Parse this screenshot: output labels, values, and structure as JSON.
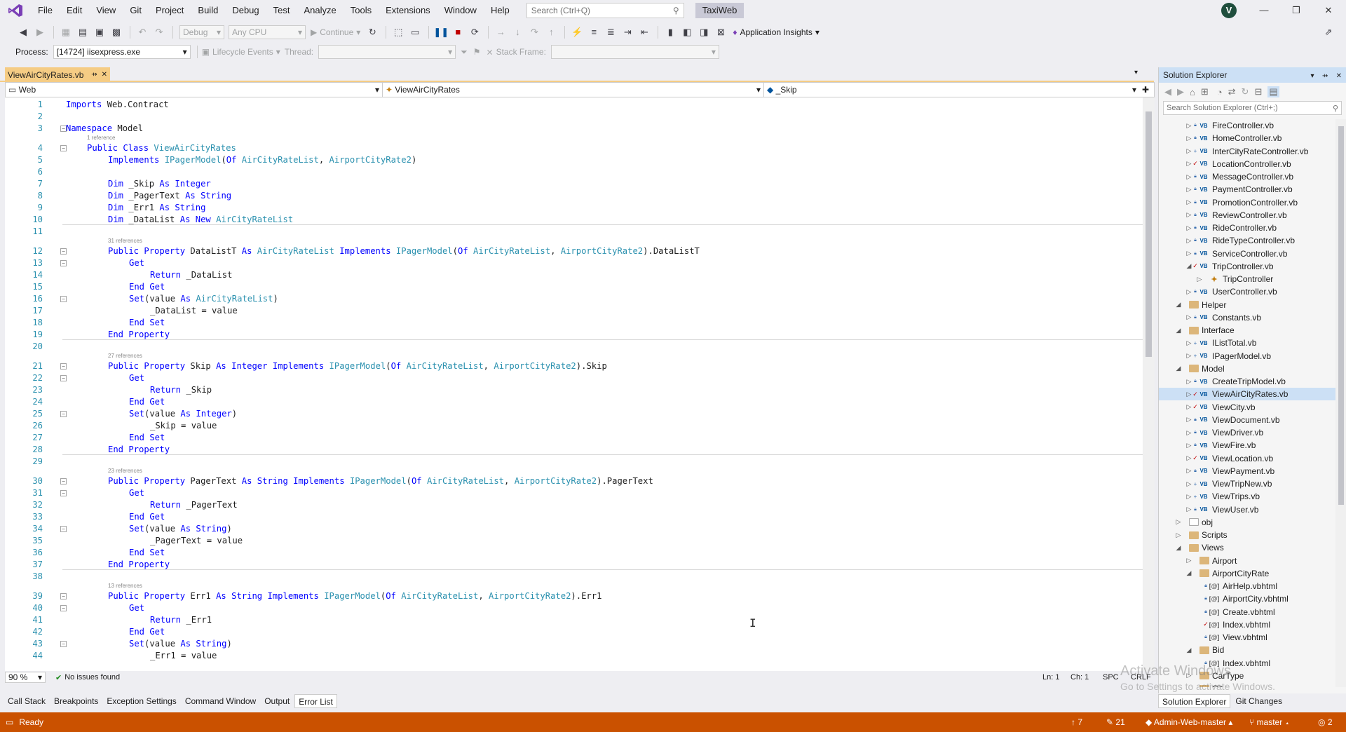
{
  "menu": [
    "File",
    "Edit",
    "View",
    "Git",
    "Project",
    "Build",
    "Debug",
    "Test",
    "Analyze",
    "Tools",
    "Extensions",
    "Window",
    "Help"
  ],
  "search": {
    "placeholder": "Search (Ctrl+Q)"
  },
  "project_name": "TaxiWeb",
  "user_initial": "V",
  "toolbar": {
    "config": "Debug",
    "platform": "Any CPU",
    "continue_label": "Continue",
    "app_insights": "Application Insights"
  },
  "debugbar": {
    "process_label": "Process:",
    "process_value": "[14724] iisexpress.exe",
    "lifecycle": "Lifecycle Events",
    "thread_label": "Thread:",
    "stack_label": "Stack Frame:"
  },
  "doc_tab": {
    "name": "ViewAirCityRates.vb",
    "pin": "⇸",
    "close": "✕"
  },
  "nav": {
    "project": "Web",
    "class": "ViewAirCityRates",
    "member": "_Skip"
  },
  "editor": {
    "lines": [
      {
        "n": "1",
        "ind": 0,
        "t": [
          [
            "k",
            "Imports"
          ],
          [
            "p",
            " Web.Contract"
          ]
        ]
      },
      {
        "n": "2",
        "ind": 0,
        "t": []
      },
      {
        "n": "3",
        "ind": 0,
        "f": "−",
        "t": [
          [
            "k",
            "Namespace"
          ],
          [
            "p",
            " Model"
          ]
        ]
      },
      {
        "n": "4",
        "ind": 1,
        "f": "−",
        "lens": "1 reference",
        "t": [
          [
            "k",
            "Public Class "
          ],
          [
            "t",
            "ViewAirCityRates"
          ]
        ]
      },
      {
        "n": "5",
        "ind": 2,
        "t": [
          [
            "k",
            "Implements "
          ],
          [
            "t",
            "IPagerModel"
          ],
          [
            "p",
            "("
          ],
          [
            "k",
            "Of "
          ],
          [
            "t",
            "AirCityRateList"
          ],
          [
            "p",
            ", "
          ],
          [
            "t",
            "AirportCityRate2"
          ],
          [
            "p",
            ")"
          ]
        ]
      },
      {
        "n": "6",
        "ind": 0,
        "t": []
      },
      {
        "n": "7",
        "ind": 2,
        "t": [
          [
            "k",
            "Dim"
          ],
          [
            "p",
            " _Skip "
          ],
          [
            "k",
            "As Integer"
          ]
        ]
      },
      {
        "n": "8",
        "ind": 2,
        "t": [
          [
            "k",
            "Dim"
          ],
          [
            "p",
            " _PagerText "
          ],
          [
            "k",
            "As String"
          ]
        ]
      },
      {
        "n": "9",
        "ind": 2,
        "t": [
          [
            "k",
            "Dim"
          ],
          [
            "p",
            " _Err1 "
          ],
          [
            "k",
            "As String"
          ]
        ]
      },
      {
        "n": "10",
        "ind": 2,
        "t": [
          [
            "k",
            "Dim"
          ],
          [
            "p",
            " _DataList "
          ],
          [
            "k",
            "As New "
          ],
          [
            "t",
            "AirCityRateList"
          ]
        ]
      },
      {
        "n": "11",
        "ind": 0,
        "sep": true,
        "t": []
      },
      {
        "n": "12",
        "ind": 2,
        "f": "−",
        "lens": "31 references",
        "t": [
          [
            "k",
            "Public Property"
          ],
          [
            "p",
            " DataListT "
          ],
          [
            "k",
            "As "
          ],
          [
            "t",
            "AirCityRateList"
          ],
          [
            "k",
            " Implements "
          ],
          [
            "t",
            "IPagerModel"
          ],
          [
            "p",
            "("
          ],
          [
            "k",
            "Of "
          ],
          [
            "t",
            "AirCityRateList"
          ],
          [
            "p",
            ", "
          ],
          [
            "t",
            "AirportCityRate2"
          ],
          [
            "p",
            ").DataListT"
          ]
        ]
      },
      {
        "n": "13",
        "ind": 3,
        "f": "−",
        "t": [
          [
            "k",
            "Get"
          ]
        ]
      },
      {
        "n": "14",
        "ind": 4,
        "t": [
          [
            "k",
            "Return"
          ],
          [
            "p",
            " _DataList"
          ]
        ]
      },
      {
        "n": "15",
        "ind": 3,
        "t": [
          [
            "k",
            "End Get"
          ]
        ]
      },
      {
        "n": "16",
        "ind": 3,
        "f": "−",
        "t": [
          [
            "k",
            "Set"
          ],
          [
            "p",
            "(value "
          ],
          [
            "k",
            "As "
          ],
          [
            "t",
            "AirCityRateList"
          ],
          [
            "p",
            ")"
          ]
        ]
      },
      {
        "n": "17",
        "ind": 4,
        "t": [
          [
            "p",
            "_DataList = value"
          ]
        ]
      },
      {
        "n": "18",
        "ind": 3,
        "t": [
          [
            "k",
            "End Set"
          ]
        ]
      },
      {
        "n": "19",
        "ind": 2,
        "t": [
          [
            "k",
            "End Property"
          ]
        ]
      },
      {
        "n": "20",
        "ind": 0,
        "sep": true,
        "t": []
      },
      {
        "n": "21",
        "ind": 2,
        "f": "−",
        "lens": "27 references",
        "t": [
          [
            "k",
            "Public Property"
          ],
          [
            "p",
            " Skip "
          ],
          [
            "k",
            "As Integer Implements "
          ],
          [
            "t",
            "IPagerModel"
          ],
          [
            "p",
            "("
          ],
          [
            "k",
            "Of "
          ],
          [
            "t",
            "AirCityRateList"
          ],
          [
            "p",
            ", "
          ],
          [
            "t",
            "AirportCityRate2"
          ],
          [
            "p",
            ").Skip"
          ]
        ]
      },
      {
        "n": "22",
        "ind": 3,
        "f": "−",
        "t": [
          [
            "k",
            "Get"
          ]
        ]
      },
      {
        "n": "23",
        "ind": 4,
        "t": [
          [
            "k",
            "Return"
          ],
          [
            "p",
            " _Skip"
          ]
        ]
      },
      {
        "n": "24",
        "ind": 3,
        "t": [
          [
            "k",
            "End Get"
          ]
        ]
      },
      {
        "n": "25",
        "ind": 3,
        "f": "−",
        "t": [
          [
            "k",
            "Set"
          ],
          [
            "p",
            "(value "
          ],
          [
            "k",
            "As Integer"
          ],
          [
            "p",
            ")"
          ]
        ]
      },
      {
        "n": "26",
        "ind": 4,
        "t": [
          [
            "p",
            "_Skip = value"
          ]
        ]
      },
      {
        "n": "27",
        "ind": 3,
        "t": [
          [
            "k",
            "End Set"
          ]
        ]
      },
      {
        "n": "28",
        "ind": 2,
        "t": [
          [
            "k",
            "End Property"
          ]
        ]
      },
      {
        "n": "29",
        "ind": 0,
        "sep": true,
        "t": []
      },
      {
        "n": "30",
        "ind": 2,
        "f": "−",
        "lens": "23 references",
        "t": [
          [
            "k",
            "Public Property"
          ],
          [
            "p",
            " PagerText "
          ],
          [
            "k",
            "As String Implements "
          ],
          [
            "t",
            "IPagerModel"
          ],
          [
            "p",
            "("
          ],
          [
            "k",
            "Of "
          ],
          [
            "t",
            "AirCityRateList"
          ],
          [
            "p",
            ", "
          ],
          [
            "t",
            "AirportCityRate2"
          ],
          [
            "p",
            ").PagerText"
          ]
        ]
      },
      {
        "n": "31",
        "ind": 3,
        "f": "−",
        "t": [
          [
            "k",
            "Get"
          ]
        ]
      },
      {
        "n": "32",
        "ind": 4,
        "t": [
          [
            "k",
            "Return"
          ],
          [
            "p",
            " _PagerText"
          ]
        ]
      },
      {
        "n": "33",
        "ind": 3,
        "t": [
          [
            "k",
            "End Get"
          ]
        ]
      },
      {
        "n": "34",
        "ind": 3,
        "f": "−",
        "t": [
          [
            "k",
            "Set"
          ],
          [
            "p",
            "(value "
          ],
          [
            "k",
            "As String"
          ],
          [
            "p",
            ")"
          ]
        ]
      },
      {
        "n": "35",
        "ind": 4,
        "t": [
          [
            "p",
            "_PagerText = value"
          ]
        ]
      },
      {
        "n": "36",
        "ind": 3,
        "t": [
          [
            "k",
            "End Set"
          ]
        ]
      },
      {
        "n": "37",
        "ind": 2,
        "t": [
          [
            "k",
            "End Property"
          ]
        ]
      },
      {
        "n": "38",
        "ind": 0,
        "sep": true,
        "t": []
      },
      {
        "n": "39",
        "ind": 2,
        "f": "−",
        "lens": "13 references",
        "t": [
          [
            "k",
            "Public Property"
          ],
          [
            "p",
            " Err1 "
          ],
          [
            "k",
            "As String Implements "
          ],
          [
            "t",
            "IPagerModel"
          ],
          [
            "p",
            "("
          ],
          [
            "k",
            "Of "
          ],
          [
            "t",
            "AirCityRateList"
          ],
          [
            "p",
            ", "
          ],
          [
            "t",
            "AirportCityRate2"
          ],
          [
            "p",
            ").Err1"
          ]
        ]
      },
      {
        "n": "40",
        "ind": 3,
        "f": "−",
        "t": [
          [
            "k",
            "Get"
          ]
        ]
      },
      {
        "n": "41",
        "ind": 4,
        "t": [
          [
            "k",
            "Return"
          ],
          [
            "p",
            " _Err1"
          ]
        ]
      },
      {
        "n": "42",
        "ind": 3,
        "t": [
          [
            "k",
            "End Get"
          ]
        ]
      },
      {
        "n": "43",
        "ind": 3,
        "f": "−",
        "t": [
          [
            "k",
            "Set"
          ],
          [
            "p",
            "(value "
          ],
          [
            "k",
            "As String"
          ],
          [
            "p",
            ")"
          ]
        ]
      },
      {
        "n": "44",
        "ind": 4,
        "t": [
          [
            "p",
            "_Err1 = value"
          ]
        ]
      }
    ]
  },
  "editor_status": {
    "zoom": "90 %",
    "issues": "No issues found",
    "ln": "Ln: 1",
    "ch": "Ch: 1",
    "spc": "SPC",
    "crlf": "CRLF"
  },
  "bottom_tabs": [
    "Call Stack",
    "Breakpoints",
    "Exception Settings",
    "Command Window",
    "Output",
    "Error List"
  ],
  "status": {
    "ready": "Ready",
    "up": "7",
    "edits": "21",
    "repo": "Admin-Web-master",
    "branch": "master",
    "notif": "2"
  },
  "solution_explorer": {
    "title": "Solution Explorer",
    "search_placeholder": "Search Solution Explorer (Ctrl+;)",
    "items": [
      {
        "label": "FireController.vb",
        "lvl": 3,
        "arrow": "▷",
        "icon": "VB",
        "mark": "lock"
      },
      {
        "label": "HomeController.vb",
        "lvl": 3,
        "arrow": "▷",
        "icon": "VB",
        "mark": "lock"
      },
      {
        "label": "InterCityRateController.vb",
        "lvl": 3,
        "arrow": "▷",
        "icon": "VB",
        "mark": "plus"
      },
      {
        "label": "LocationController.vb",
        "lvl": 3,
        "arrow": "▷",
        "icon": "VB",
        "mark": "check"
      },
      {
        "label": "MessageController.vb",
        "lvl": 3,
        "arrow": "▷",
        "icon": "VB",
        "mark": "lock"
      },
      {
        "label": "PaymentController.vb",
        "lvl": 3,
        "arrow": "▷",
        "icon": "VB",
        "mark": "lock"
      },
      {
        "label": "PromotionController.vb",
        "lvl": 3,
        "arrow": "▷",
        "icon": "VB",
        "mark": "lock"
      },
      {
        "label": "ReviewController.vb",
        "lvl": 3,
        "arrow": "▷",
        "icon": "VB",
        "mark": "lock"
      },
      {
        "label": "RideController.vb",
        "lvl": 3,
        "arrow": "▷",
        "icon": "VB",
        "mark": "lock"
      },
      {
        "label": "RideTypeController.vb",
        "lvl": 3,
        "arrow": "▷",
        "icon": "VB",
        "mark": "lock"
      },
      {
        "label": "ServiceController.vb",
        "lvl": 3,
        "arrow": "▷",
        "icon": "VB",
        "mark": "lock"
      },
      {
        "label": "TripController.vb",
        "lvl": 3,
        "arrow": "◢",
        "icon": "VB",
        "mark": "check"
      },
      {
        "label": "TripController",
        "lvl": 4,
        "arrow": "▷",
        "icon": "cls",
        "mark": ""
      },
      {
        "label": "UserController.vb",
        "lvl": 3,
        "arrow": "▷",
        "icon": "VB",
        "mark": "lock"
      },
      {
        "label": "Helper",
        "lvl": 2,
        "arrow": "◢",
        "icon": "folder",
        "mark": ""
      },
      {
        "label": "Constants.vb",
        "lvl": 3,
        "arrow": "▷",
        "icon": "VB",
        "mark": "lock"
      },
      {
        "label": "Interface",
        "lvl": 2,
        "arrow": "◢",
        "icon": "folder",
        "mark": ""
      },
      {
        "label": "IListTotal.vb",
        "lvl": 3,
        "arrow": "▷",
        "icon": "VB",
        "mark": "plus"
      },
      {
        "label": "IPagerModel.vb",
        "lvl": 3,
        "arrow": "▷",
        "icon": "VB",
        "mark": "plus"
      },
      {
        "label": "Model",
        "lvl": 2,
        "arrow": "◢",
        "icon": "folder",
        "mark": ""
      },
      {
        "label": "CreateTripModel.vb",
        "lvl": 3,
        "arrow": "▷",
        "icon": "VB",
        "mark": "lock"
      },
      {
        "label": "ViewAirCityRates.vb",
        "lvl": 3,
        "arrow": "▷",
        "icon": "VB",
        "mark": "check",
        "sel": true
      },
      {
        "label": "ViewCity.vb",
        "lvl": 3,
        "arrow": "▷",
        "icon": "VB",
        "mark": "check"
      },
      {
        "label": "ViewDocument.vb",
        "lvl": 3,
        "arrow": "▷",
        "icon": "VB",
        "mark": "lock"
      },
      {
        "label": "ViewDriver.vb",
        "lvl": 3,
        "arrow": "▷",
        "icon": "VB",
        "mark": "lock"
      },
      {
        "label": "ViewFire.vb",
        "lvl": 3,
        "arrow": "▷",
        "icon": "VB",
        "mark": "lock"
      },
      {
        "label": "ViewLocation.vb",
        "lvl": 3,
        "arrow": "▷",
        "icon": "VB",
        "mark": "check"
      },
      {
        "label": "ViewPayment.vb",
        "lvl": 3,
        "arrow": "▷",
        "icon": "VB",
        "mark": "lock"
      },
      {
        "label": "ViewTripNew.vb",
        "lvl": 3,
        "arrow": "▷",
        "icon": "VB",
        "mark": "plus"
      },
      {
        "label": "ViewTrips.vb",
        "lvl": 3,
        "arrow": "▷",
        "icon": "VB",
        "mark": "plus"
      },
      {
        "label": "ViewUser.vb",
        "lvl": 3,
        "arrow": "▷",
        "icon": "VB",
        "mark": "lock"
      },
      {
        "label": "obj",
        "lvl": 2,
        "arrow": "▷",
        "icon": "folder-empty",
        "mark": ""
      },
      {
        "label": "Scripts",
        "lvl": 2,
        "arrow": "▷",
        "icon": "folder",
        "mark": ""
      },
      {
        "label": "Views",
        "lvl": 2,
        "arrow": "◢",
        "icon": "folder",
        "mark": ""
      },
      {
        "label": "Airport",
        "lvl": 3,
        "arrow": "▷",
        "icon": "folder",
        "mark": ""
      },
      {
        "label": "AirportCityRate",
        "lvl": 3,
        "arrow": "◢",
        "icon": "folder",
        "mark": ""
      },
      {
        "label": "AirHelp.vbhtml",
        "lvl": 4,
        "arrow": "",
        "icon": "html",
        "mark": "lock"
      },
      {
        "label": "AirportCity.vbhtml",
        "lvl": 4,
        "arrow": "",
        "icon": "html",
        "mark": "lock"
      },
      {
        "label": "Create.vbhtml",
        "lvl": 4,
        "arrow": "",
        "icon": "html",
        "mark": "lock"
      },
      {
        "label": "Index.vbhtml",
        "lvl": 4,
        "arrow": "",
        "icon": "html",
        "mark": "check"
      },
      {
        "label": "View.vbhtml",
        "lvl": 4,
        "arrow": "",
        "icon": "html",
        "mark": "lock"
      },
      {
        "label": "Bid",
        "lvl": 3,
        "arrow": "◢",
        "icon": "folder",
        "mark": ""
      },
      {
        "label": "Index.vbhtml",
        "lvl": 4,
        "arrow": "",
        "icon": "html",
        "mark": "lock"
      },
      {
        "label": "CarType",
        "lvl": 3,
        "arrow": "▷",
        "icon": "folder",
        "mark": ""
      },
      {
        "label": "City",
        "lvl": 3,
        "arrow": "◢",
        "icon": "folder",
        "mark": ""
      }
    ]
  },
  "se_bottom_tabs": [
    "Solution Explorer",
    "Git Changes"
  ],
  "watermark": {
    "line1": "Activate Windows",
    "line2": "Go to Settings to activate Windows."
  }
}
